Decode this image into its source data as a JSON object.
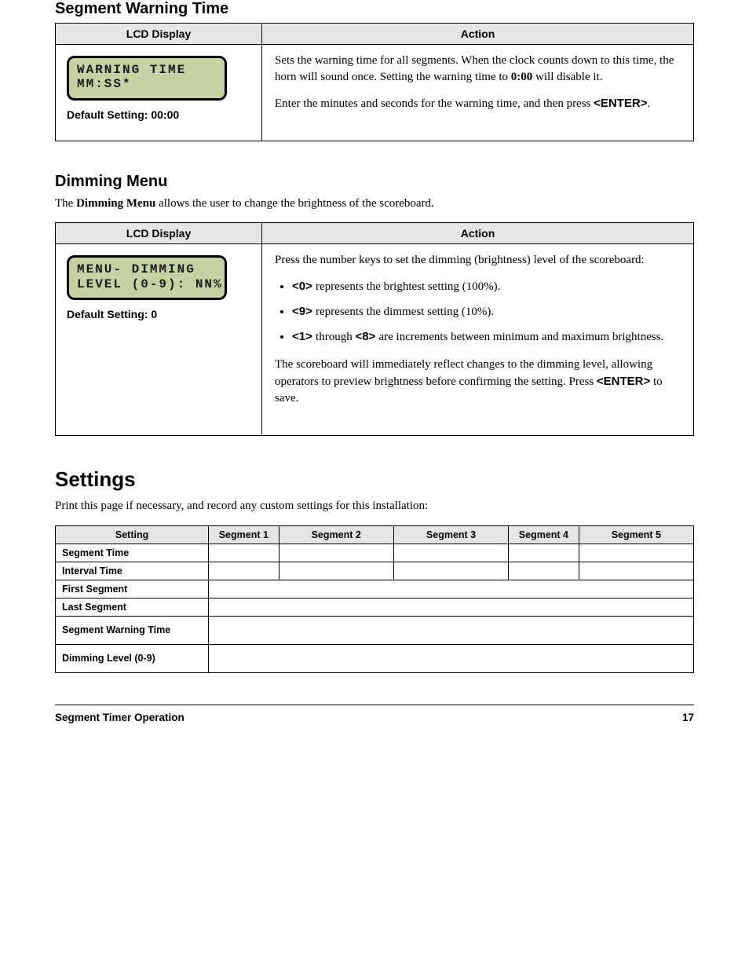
{
  "section1": {
    "heading": "Segment Warning Time",
    "lcd": "WARNING TIME\nMM:SS*",
    "default_label": "Default Setting: ",
    "default_value": "00:00",
    "para1_a": "Sets the warning time for all segments. When the clock counts down to this time, the horn will sound once. Setting the warning time to ",
    "para1_b": "0:00",
    "para1_c": " will disable it.",
    "para2_a": "Enter the minutes and seconds for the warning time, and then press ",
    "para2_btn": "<ENTER>",
    "para2_b": ".",
    "cols": {
      "left": "LCD Display",
      "right": "Action"
    }
  },
  "section2": {
    "heading": "Dimming Menu",
    "intro_a": "The ",
    "intro_b": "Dimming Menu",
    "intro_c": " allows the user to change the brightness of the scoreboard.",
    "lcd": "MENU- DIMMING\nLEVEL (0-9): NN%",
    "default_label": "Default Setting: ",
    "default_value": "0",
    "para1": "Press the number keys to set the dimming (brightness) level of the scoreboard:",
    "list": [
      {
        "a": "<0> ",
        "b": "represents the brightest setting (100%)."
      },
      {
        "a": "<9> ",
        "b": "represents the dimmest setting (10%)."
      },
      {
        "a": "<1> ",
        "b": "through ",
        "c": "<8> ",
        "d": "are increments between minimum and maximum brightness."
      }
    ],
    "para2_a": "The scoreboard will immediately reflect changes to the dimming level, allowing operators to preview brightness before confirming the setting. Press ",
    "para2_btn": "<ENTER>",
    "para2_b": " to save.",
    "cols": {
      "left": "LCD Display",
      "right": "Action"
    }
  },
  "worksheet": {
    "heading": "Settings",
    "intro": "Print this page if necessary, and record any custom settings for this installation:",
    "headers": [
      "Setting",
      "Segment 1",
      "Segment 2",
      "Segment 3",
      "Segment 4",
      "Segment 5"
    ],
    "rows": [
      {
        "label": "Segment Time",
        "cells": [
          "",
          "",
          "",
          "",
          ""
        ]
      },
      {
        "label": "Interval Time",
        "cells": [
          "",
          "",
          "",
          "",
          ""
        ]
      },
      {
        "label": "First Segment",
        "span": true,
        "cell": ""
      },
      {
        "label": "Last Segment",
        "span": true,
        "cell": ""
      },
      {
        "label": "Segment Warning Time",
        "span": true,
        "cell": ""
      },
      {
        "label": "Dimming Level (0-9)",
        "span": true,
        "cell": ""
      }
    ]
  },
  "footer": {
    "left": "Segment Timer Operation",
    "right": "17"
  }
}
